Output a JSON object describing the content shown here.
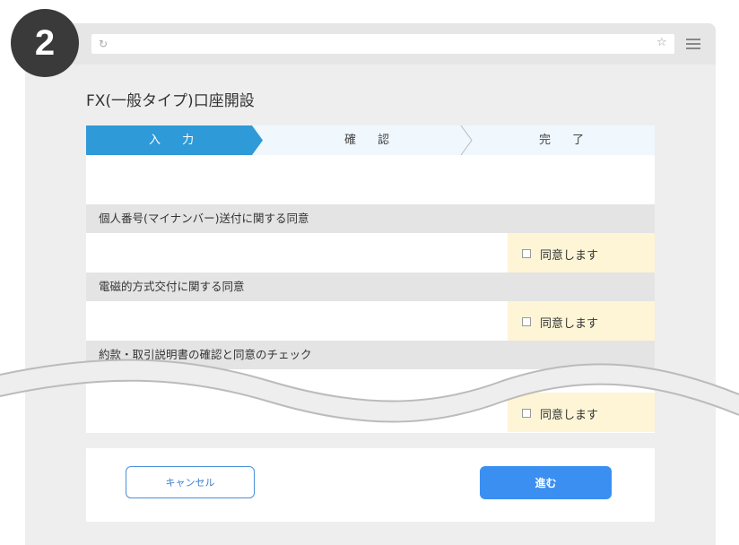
{
  "step_number": "2",
  "browser": {
    "reload_icon": "↻",
    "star_icon": "☆"
  },
  "page_title": "FX(一般タイプ)口座開設",
  "stepper": [
    {
      "label": "入 力",
      "active": true
    },
    {
      "label": "確 認",
      "active": false
    },
    {
      "label": "完 了",
      "active": false
    }
  ],
  "sections": [
    {
      "heading": "個人番号(マイナンバー)送付に関する同意",
      "agree_label": "同意します"
    },
    {
      "heading": "電磁的方式交付に関する同意",
      "agree_label": "同意します"
    },
    {
      "heading": "約款・取引説明書の確認と同意のチェック",
      "agree_label": "同意します"
    }
  ],
  "buttons": {
    "cancel": "キャンセル",
    "next": "進む"
  },
  "colors": {
    "accent": "#3b8ff0",
    "step_active": "#2f9ad8",
    "agree_bg": "#fdf5d6"
  }
}
